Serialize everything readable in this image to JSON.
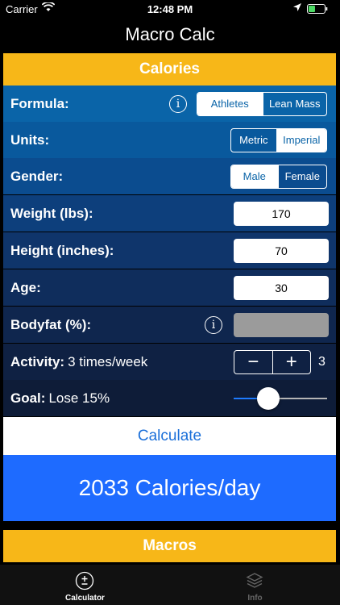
{
  "status_bar": {
    "carrier": "Carrier",
    "time": "12:48 PM"
  },
  "nav": {
    "title": "Macro Calc"
  },
  "calories_header": "Calories",
  "formula": {
    "label": "Formula:",
    "options": [
      "Athletes",
      "Lean Mass"
    ],
    "selected": "Athletes"
  },
  "units": {
    "label": "Units:",
    "options": [
      "Metric",
      "Imperial"
    ],
    "selected": "Imperial"
  },
  "gender": {
    "label": "Gender:",
    "options": [
      "Male",
      "Female"
    ],
    "selected": "Male"
  },
  "weight": {
    "label": "Weight (lbs):",
    "value": "170"
  },
  "height": {
    "label": "Height (inches):",
    "value": "70"
  },
  "age": {
    "label": "Age:",
    "value": "30"
  },
  "bodyfat": {
    "label": "Bodyfat (%):",
    "value": ""
  },
  "activity": {
    "label": "Activity:",
    "description": "3 times/week",
    "value": "3",
    "minus": "−",
    "plus": "+"
  },
  "goal": {
    "label": "Goal:",
    "description": "Lose 15%",
    "slider_fraction": 0.37
  },
  "calculate_label": "Calculate",
  "result_text": "2033 Calories/day",
  "macros_header": "Macros",
  "tabs": [
    {
      "label": "Calculator",
      "active": true
    },
    {
      "label": "Info",
      "active": false
    }
  ],
  "colors": {
    "accent_yellow": "#F7B718",
    "result_blue": "#1E6BFF",
    "row_gradient": [
      "#0A64A8",
      "#09599D",
      "#0B4C8F",
      "#0D3F7C",
      "#0F356B",
      "#0F2D5C",
      "#0F264E",
      "#0F2143",
      "#0E1C38"
    ]
  }
}
